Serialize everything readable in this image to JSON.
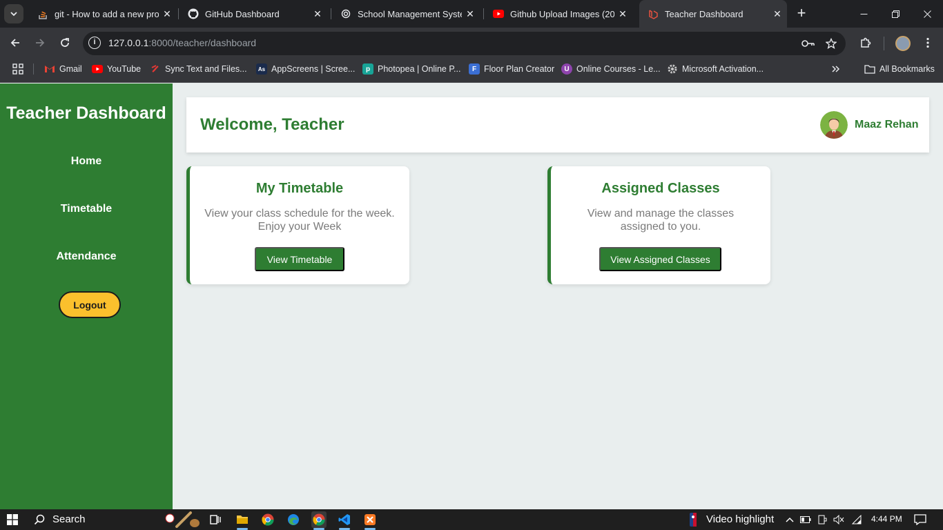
{
  "browser": {
    "tabs": [
      {
        "title": "git - How to add a new proje",
        "icon": "stackoverflow-icon"
      },
      {
        "title": "GitHub Dashboard",
        "icon": "github-icon"
      },
      {
        "title": "School Management System",
        "icon": "openai-icon"
      },
      {
        "title": "Github Upload Images (2022",
        "icon": "youtube-icon"
      },
      {
        "title": "Teacher Dashboard",
        "icon": "laravel-icon",
        "active": true
      }
    ],
    "url_host": "127.0.0.1",
    "url_path": ":8000/teacher/dashboard",
    "bookmarks": [
      {
        "label": "Gmail",
        "icon": "gmail-icon"
      },
      {
        "label": "YouTube",
        "icon": "youtube-icon"
      },
      {
        "label": "Sync Text and Files...",
        "icon": "sync-icon"
      },
      {
        "label": "AppScreens | Scree...",
        "icon": "appscreens-icon"
      },
      {
        "label": "Photopea | Online P...",
        "icon": "photopea-icon"
      },
      {
        "label": "Floor Plan Creator",
        "icon": "floorplan-icon"
      },
      {
        "label": "Online Courses - Le...",
        "icon": "udemy-icon"
      },
      {
        "label": "Microsoft Activation...",
        "icon": "gear-icon"
      }
    ],
    "all_bookmarks": "All Bookmarks"
  },
  "sidebar": {
    "title": "Teacher Dashboard",
    "links": [
      "Home",
      "Timetable",
      "Attendance"
    ],
    "logout": "Logout"
  },
  "header": {
    "welcome": "Welcome, Teacher",
    "user_name": "Maaz Rehan"
  },
  "cards": [
    {
      "title": "My Timetable",
      "desc_line1": "View your class schedule for the week.",
      "desc_line2": "Enjoy your Week",
      "button": "View Timetable"
    },
    {
      "title": "Assigned Classes",
      "desc_line1": "View and manage the classes",
      "desc_line2": "assigned to you.",
      "button": "View Assigned Classes"
    }
  ],
  "taskbar": {
    "search": "Search",
    "notification": "Video highlight",
    "time": "4:44 PM"
  },
  "colors": {
    "primary_green": "#2e7d32",
    "logout_yellow": "#fbc02d",
    "page_bg": "#e9eeee"
  }
}
